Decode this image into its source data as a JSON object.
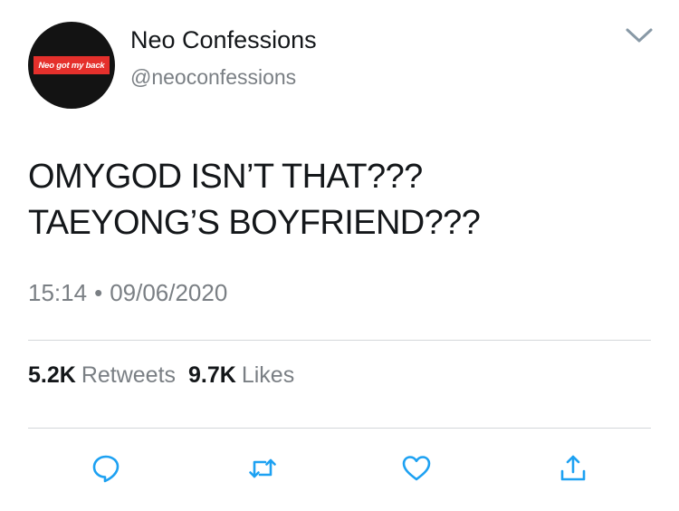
{
  "author": {
    "display_name": "Neo Confessions",
    "handle": "@neoconfessions",
    "avatar_text": "Neo got my back"
  },
  "tweet": {
    "lines": [
      "OMYGOD ISN’T THAT???",
      "TAEYONG’S BOYFRIEND???"
    ],
    "time": "15:14",
    "separator": "•",
    "date": "09/06/2020"
  },
  "stats": {
    "retweets_count": "5.2K",
    "retweets_label": "Retweets",
    "likes_count": "9.7K",
    "likes_label": "Likes"
  },
  "icons": {
    "caret": "chevron-down-icon",
    "reply": "reply-icon",
    "retweet": "retweet-icon",
    "like": "heart-icon",
    "share": "share-icon"
  },
  "colors": {
    "text": "#14171a",
    "secondary": "#7a7f84",
    "icon": "#1da1f2",
    "avatar_bg": "#131313",
    "avatar_label": "#e5302c"
  }
}
